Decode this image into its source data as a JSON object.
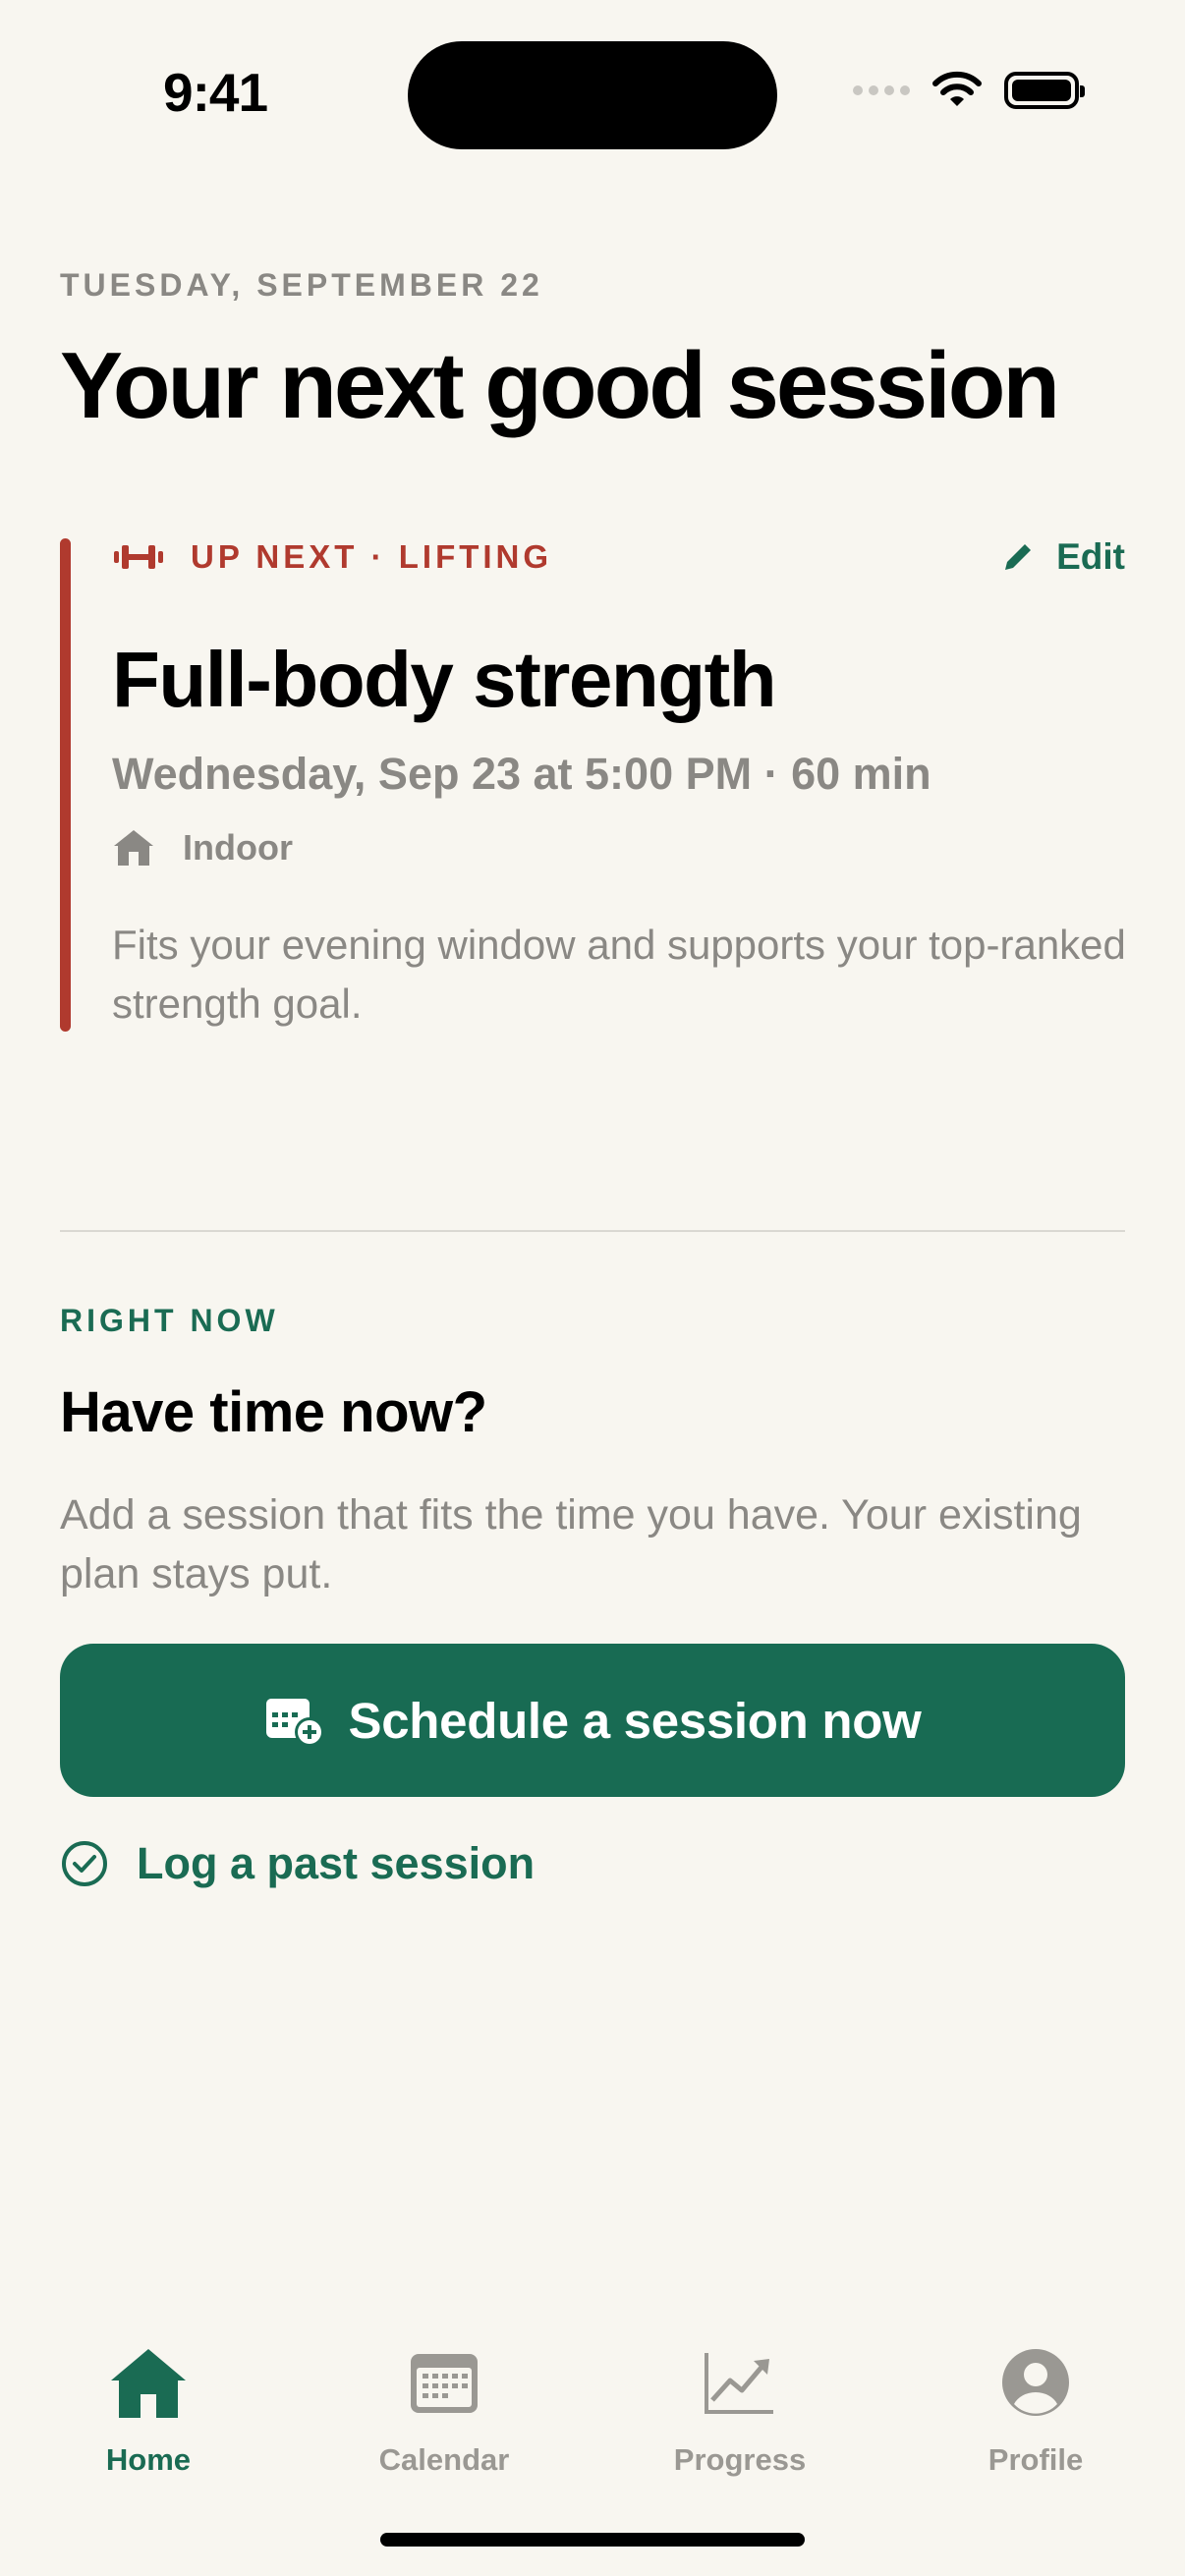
{
  "status_bar": {
    "time": "9:41"
  },
  "header": {
    "date": "TUESDAY, SEPTEMBER 22",
    "title": "Your next good session"
  },
  "up_next": {
    "eyebrow": "UP NEXT · LIFTING",
    "edit_label": "Edit",
    "title": "Full-body strength",
    "meta": "Wednesday, Sep 23 at 5:00 PM · 60 min",
    "location": "Indoor",
    "description": "Fits your evening window and supports your top-ranked strength goal.",
    "accent_color": "#B03A2E"
  },
  "right_now": {
    "eyebrow": "RIGHT NOW",
    "title": "Have time now?",
    "description": "Add a session that fits the time you have. Your existing plan stays put.",
    "primary_button": "Schedule a session now",
    "secondary_link": "Log a past session",
    "brand_color": "#186B53"
  },
  "tabs": [
    {
      "label": "Home",
      "icon": "home-icon",
      "active": true
    },
    {
      "label": "Calendar",
      "icon": "calendar-icon",
      "active": false
    },
    {
      "label": "Progress",
      "icon": "chart-icon",
      "active": false
    },
    {
      "label": "Profile",
      "icon": "profile-icon",
      "active": false
    }
  ]
}
